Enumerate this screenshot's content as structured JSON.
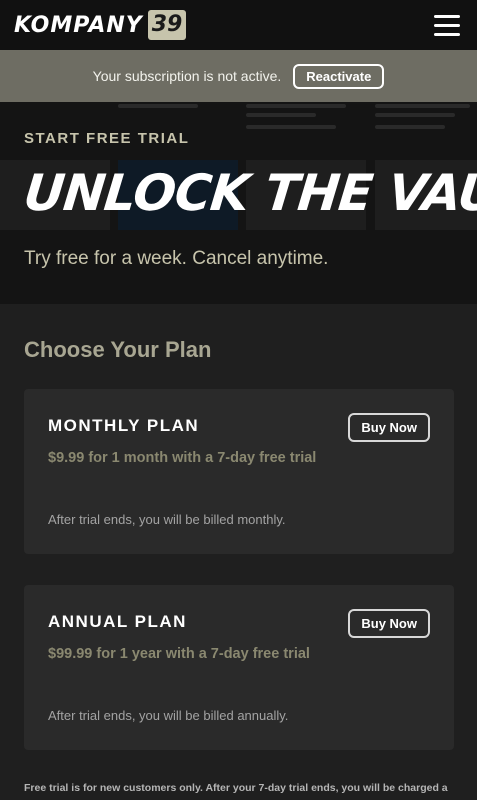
{
  "header": {
    "logo_word": "KOMPANY",
    "logo_badge": "39",
    "logo_badge_color": "#c7c4ac",
    "menu_icon": "hamburger-icon"
  },
  "notice": {
    "message": "Your subscription is not active.",
    "action_label": "Reactivate"
  },
  "hero": {
    "eyebrow": "START FREE TRIAL",
    "title": "UNLOCK THE VAULT",
    "subtitle": "Try free for a week. Cancel anytime."
  },
  "plans_section": {
    "title": "Choose Your Plan",
    "plans": [
      {
        "name": "MONTHLY PLAN",
        "price": "$9.99 for 1 month with a 7-day free trial",
        "note": "After trial ends, you will be billed monthly.",
        "button_label": "Buy Now"
      },
      {
        "name": "ANNUAL PLAN",
        "price": "$99.99 for 1 year with a 7-day free trial",
        "note": "After trial ends, you will be billed annually.",
        "button_label": "Buy Now"
      }
    ]
  },
  "footnote": "Free trial is for new customers only. After your 7-day trial ends, you will be charged a",
  "colors": {
    "accent_khaki": "#c7c4ac",
    "price_text": "#8a8870",
    "notice_bar": "#6e6d63",
    "background": "#1f1f1f"
  }
}
